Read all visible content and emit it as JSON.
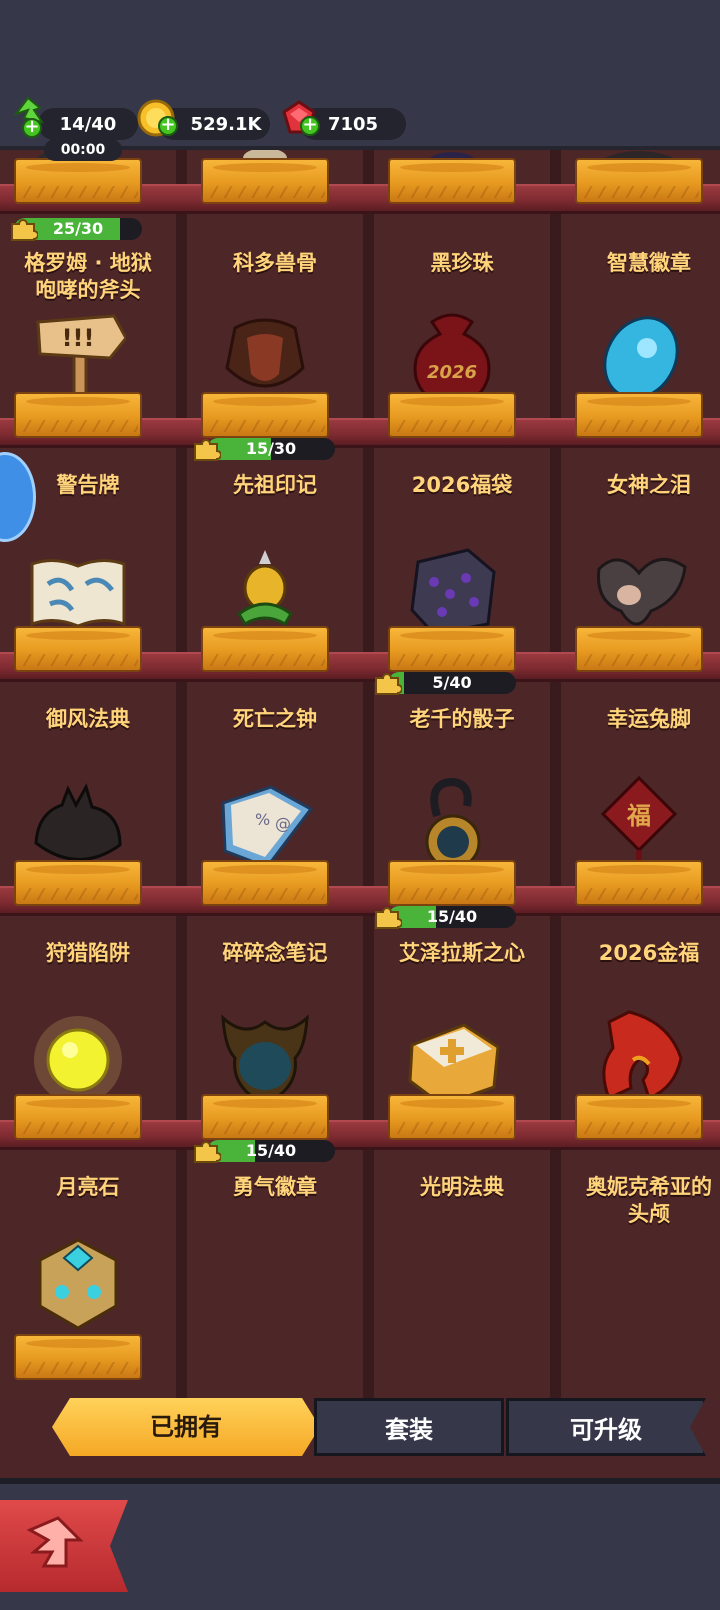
{
  "status": {
    "energy": "14/40",
    "timer": "00:00",
    "gold": "529.1K",
    "gems": "7105"
  },
  "collection": [
    {
      "name": "格罗姆 · 地狱\n咆哮的斧头",
      "progress": "25/30",
      "fraction": 0.83
    },
    {
      "name": "科多兽骨"
    },
    {
      "name": "黑珍珠"
    },
    {
      "name": "智慧徽章"
    },
    {
      "name": "警告牌"
    },
    {
      "name": "先祖印记",
      "progress": "15/30",
      "fraction": 0.5
    },
    {
      "name": "2026福袋"
    },
    {
      "name": "女神之泪"
    },
    {
      "name": "御风法典"
    },
    {
      "name": "死亡之钟"
    },
    {
      "name": "老千的骰子",
      "progress": "5/40",
      "fraction": 0.125
    },
    {
      "name": "幸运兔脚"
    },
    {
      "name": "狩猎陷阱"
    },
    {
      "name": "碎碎念笔记"
    },
    {
      "name": "艾泽拉斯之心",
      "progress": "15/40",
      "fraction": 0.375
    },
    {
      "name": "2026金福"
    },
    {
      "name": "月亮石"
    },
    {
      "name": "勇气徽章",
      "progress": "15/40",
      "fraction": 0.375
    },
    {
      "name": "光明法典"
    },
    {
      "name": "奥妮克希亚的\n头颅"
    },
    {
      "name": ""
    }
  ],
  "tabs": {
    "owned": "已拥有",
    "sets": "套装",
    "upgradable": "可升级"
  },
  "colors": {
    "accent": "#f5a825",
    "label": "#ffd47a",
    "panel": "#363849",
    "back": "#c83236"
  }
}
